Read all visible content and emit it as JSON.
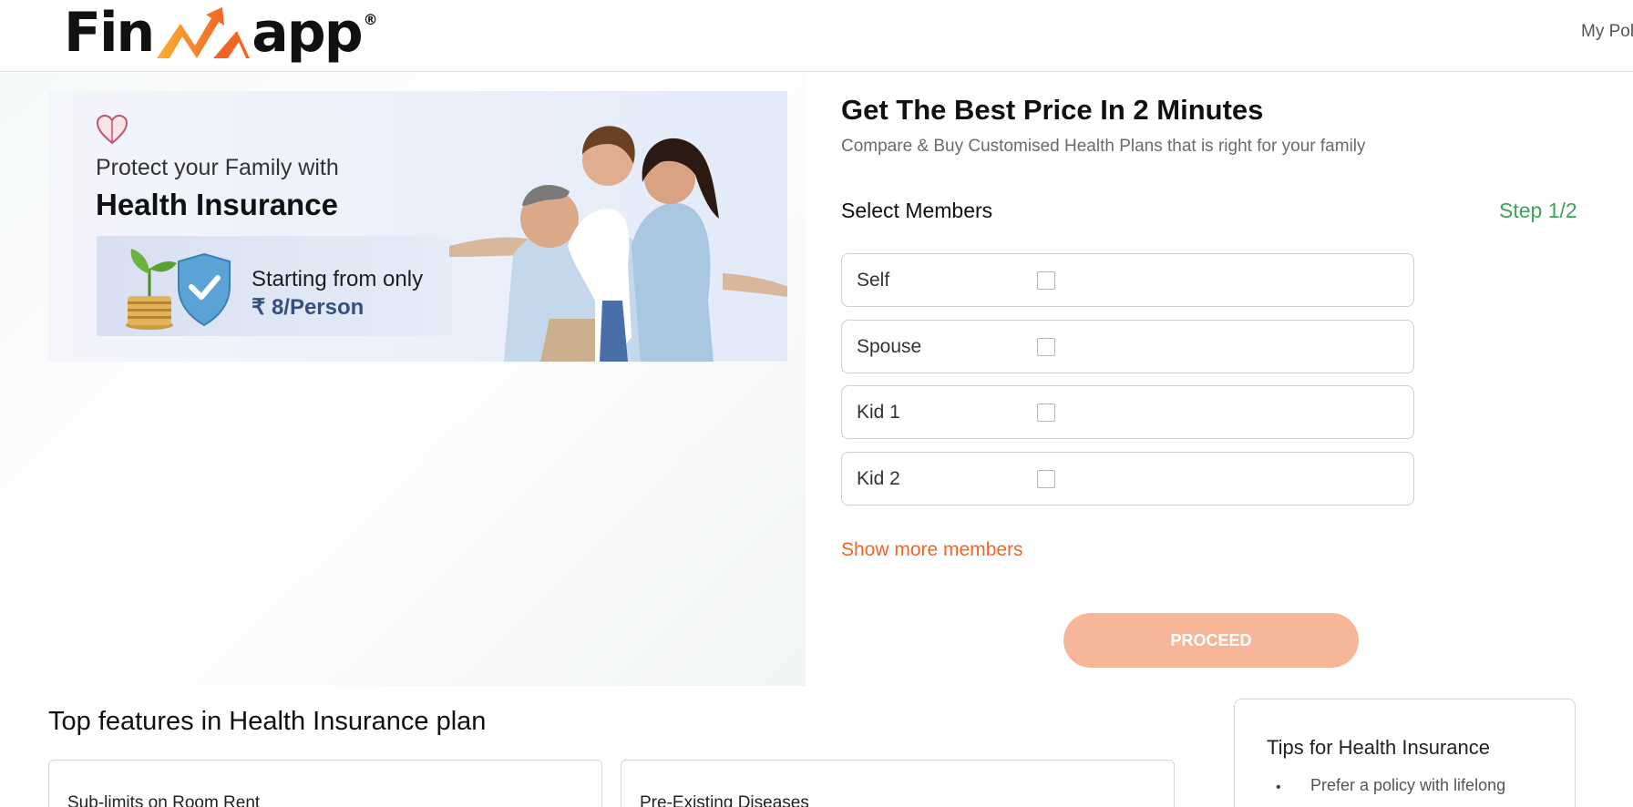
{
  "header": {
    "logo": {
      "left": "Fin",
      "right": "app",
      "reg": "®"
    },
    "nav_link": "My Poli"
  },
  "banner": {
    "line1": "Protect your Family with",
    "line2": "Health Insurance",
    "promo_line1": "Starting from only",
    "promo_line2": "₹ 8/Person"
  },
  "form": {
    "title": "Get The Best Price In 2 Minutes",
    "subtitle": "Compare & Buy Customised Health Plans that is right for your family",
    "select_label": "Select Members",
    "step": "Step 1/2",
    "members": [
      {
        "label": "Self",
        "checked": false
      },
      {
        "label": "Spouse",
        "checked": false
      },
      {
        "label": "Kid 1",
        "checked": false
      },
      {
        "label": "Kid 2",
        "checked": false
      }
    ],
    "show_more": "Show more members",
    "proceed": "PROCEED"
  },
  "features": {
    "heading": "Top features in Health Insurance plan",
    "cards": [
      "Sub-limits on Room Rent",
      "Pre-Existing Diseases"
    ]
  },
  "tips": {
    "title": "Tips for Health Insurance",
    "bullet": "•",
    "items": [
      "Prefer a policy with lifelong"
    ]
  },
  "colors": {
    "accent_orange": "#f26522",
    "proceed_bg": "#f8b698",
    "step_green": "#3aa55b",
    "promo_blue": "#35507e"
  },
  "icons": [
    "heart-icon",
    "logo-arrow-icon",
    "plant-coins-shield-icon"
  ]
}
